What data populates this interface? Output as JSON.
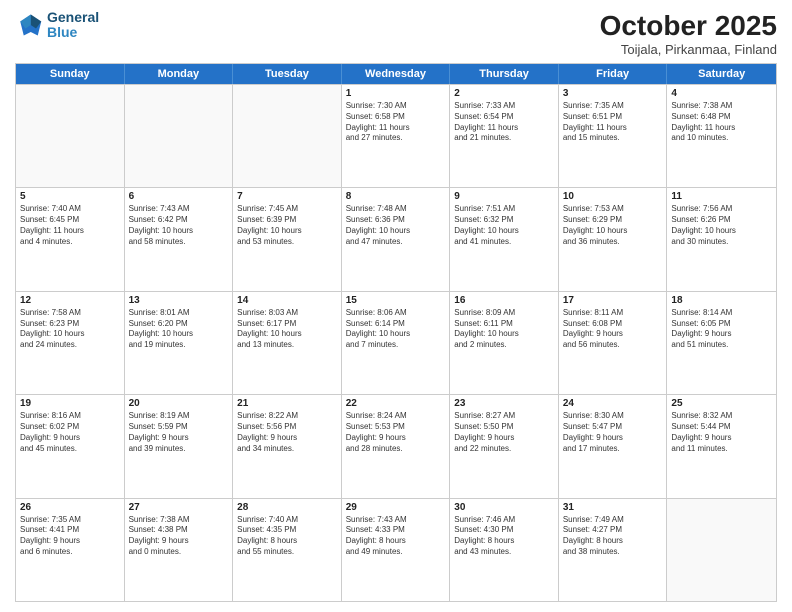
{
  "logo": {
    "line1": "General",
    "line2": "Blue"
  },
  "title": "October 2025",
  "subtitle": "Toijala, Pirkanmaa, Finland",
  "header_days": [
    "Sunday",
    "Monday",
    "Tuesday",
    "Wednesday",
    "Thursday",
    "Friday",
    "Saturday"
  ],
  "rows": [
    [
      {
        "day": "",
        "info": ""
      },
      {
        "day": "",
        "info": ""
      },
      {
        "day": "",
        "info": ""
      },
      {
        "day": "1",
        "info": "Sunrise: 7:30 AM\nSunset: 6:58 PM\nDaylight: 11 hours\nand 27 minutes."
      },
      {
        "day": "2",
        "info": "Sunrise: 7:33 AM\nSunset: 6:54 PM\nDaylight: 11 hours\nand 21 minutes."
      },
      {
        "day": "3",
        "info": "Sunrise: 7:35 AM\nSunset: 6:51 PM\nDaylight: 11 hours\nand 15 minutes."
      },
      {
        "day": "4",
        "info": "Sunrise: 7:38 AM\nSunset: 6:48 PM\nDaylight: 11 hours\nand 10 minutes."
      }
    ],
    [
      {
        "day": "5",
        "info": "Sunrise: 7:40 AM\nSunset: 6:45 PM\nDaylight: 11 hours\nand 4 minutes."
      },
      {
        "day": "6",
        "info": "Sunrise: 7:43 AM\nSunset: 6:42 PM\nDaylight: 10 hours\nand 58 minutes."
      },
      {
        "day": "7",
        "info": "Sunrise: 7:45 AM\nSunset: 6:39 PM\nDaylight: 10 hours\nand 53 minutes."
      },
      {
        "day": "8",
        "info": "Sunrise: 7:48 AM\nSunset: 6:36 PM\nDaylight: 10 hours\nand 47 minutes."
      },
      {
        "day": "9",
        "info": "Sunrise: 7:51 AM\nSunset: 6:32 PM\nDaylight: 10 hours\nand 41 minutes."
      },
      {
        "day": "10",
        "info": "Sunrise: 7:53 AM\nSunset: 6:29 PM\nDaylight: 10 hours\nand 36 minutes."
      },
      {
        "day": "11",
        "info": "Sunrise: 7:56 AM\nSunset: 6:26 PM\nDaylight: 10 hours\nand 30 minutes."
      }
    ],
    [
      {
        "day": "12",
        "info": "Sunrise: 7:58 AM\nSunset: 6:23 PM\nDaylight: 10 hours\nand 24 minutes."
      },
      {
        "day": "13",
        "info": "Sunrise: 8:01 AM\nSunset: 6:20 PM\nDaylight: 10 hours\nand 19 minutes."
      },
      {
        "day": "14",
        "info": "Sunrise: 8:03 AM\nSunset: 6:17 PM\nDaylight: 10 hours\nand 13 minutes."
      },
      {
        "day": "15",
        "info": "Sunrise: 8:06 AM\nSunset: 6:14 PM\nDaylight: 10 hours\nand 7 minutes."
      },
      {
        "day": "16",
        "info": "Sunrise: 8:09 AM\nSunset: 6:11 PM\nDaylight: 10 hours\nand 2 minutes."
      },
      {
        "day": "17",
        "info": "Sunrise: 8:11 AM\nSunset: 6:08 PM\nDaylight: 9 hours\nand 56 minutes."
      },
      {
        "day": "18",
        "info": "Sunrise: 8:14 AM\nSunset: 6:05 PM\nDaylight: 9 hours\nand 51 minutes."
      }
    ],
    [
      {
        "day": "19",
        "info": "Sunrise: 8:16 AM\nSunset: 6:02 PM\nDaylight: 9 hours\nand 45 minutes."
      },
      {
        "day": "20",
        "info": "Sunrise: 8:19 AM\nSunset: 5:59 PM\nDaylight: 9 hours\nand 39 minutes."
      },
      {
        "day": "21",
        "info": "Sunrise: 8:22 AM\nSunset: 5:56 PM\nDaylight: 9 hours\nand 34 minutes."
      },
      {
        "day": "22",
        "info": "Sunrise: 8:24 AM\nSunset: 5:53 PM\nDaylight: 9 hours\nand 28 minutes."
      },
      {
        "day": "23",
        "info": "Sunrise: 8:27 AM\nSunset: 5:50 PM\nDaylight: 9 hours\nand 22 minutes."
      },
      {
        "day": "24",
        "info": "Sunrise: 8:30 AM\nSunset: 5:47 PM\nDaylight: 9 hours\nand 17 minutes."
      },
      {
        "day": "25",
        "info": "Sunrise: 8:32 AM\nSunset: 5:44 PM\nDaylight: 9 hours\nand 11 minutes."
      }
    ],
    [
      {
        "day": "26",
        "info": "Sunrise: 7:35 AM\nSunset: 4:41 PM\nDaylight: 9 hours\nand 6 minutes."
      },
      {
        "day": "27",
        "info": "Sunrise: 7:38 AM\nSunset: 4:38 PM\nDaylight: 9 hours\nand 0 minutes."
      },
      {
        "day": "28",
        "info": "Sunrise: 7:40 AM\nSunset: 4:35 PM\nDaylight: 8 hours\nand 55 minutes."
      },
      {
        "day": "29",
        "info": "Sunrise: 7:43 AM\nSunset: 4:33 PM\nDaylight: 8 hours\nand 49 minutes."
      },
      {
        "day": "30",
        "info": "Sunrise: 7:46 AM\nSunset: 4:30 PM\nDaylight: 8 hours\nand 43 minutes."
      },
      {
        "day": "31",
        "info": "Sunrise: 7:49 AM\nSunset: 4:27 PM\nDaylight: 8 hours\nand 38 minutes."
      },
      {
        "day": "",
        "info": ""
      }
    ]
  ]
}
